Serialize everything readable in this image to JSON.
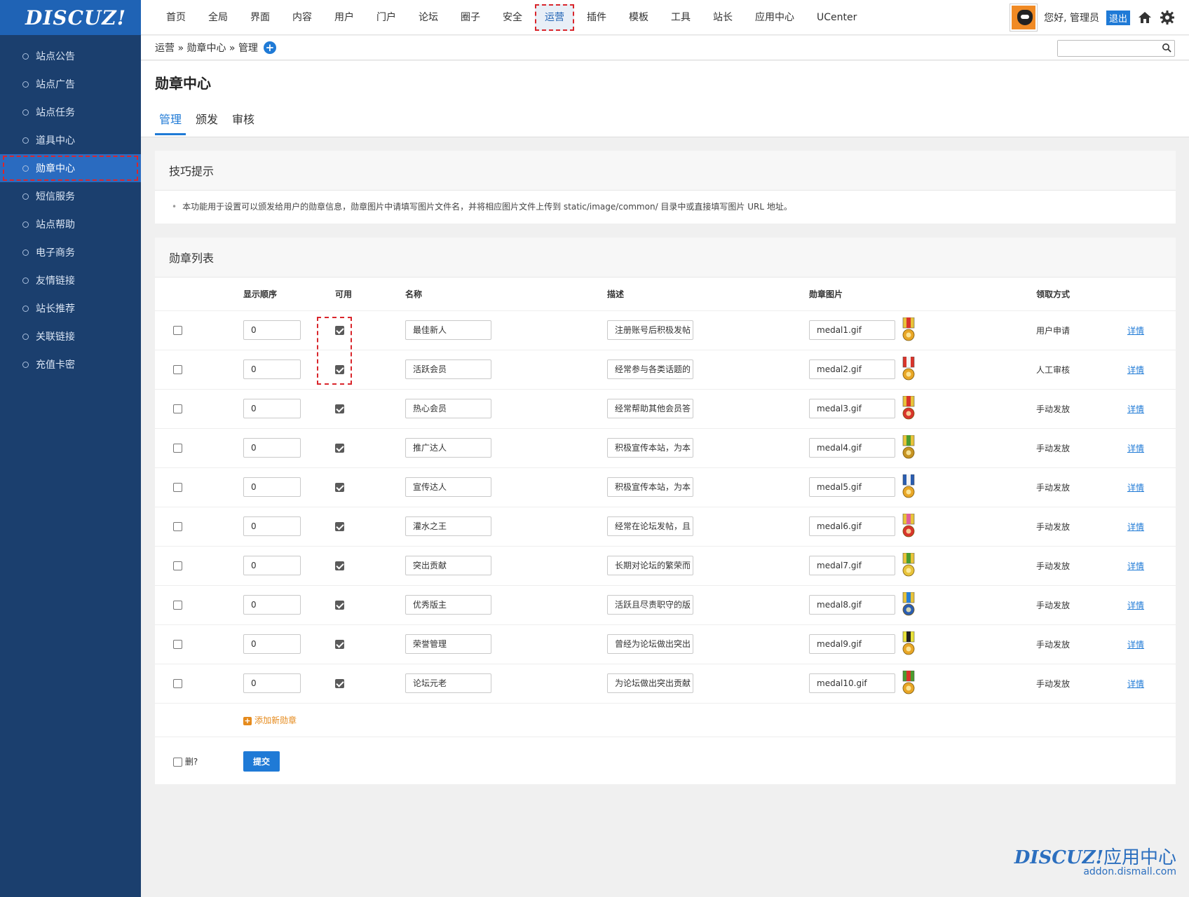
{
  "logo": "DISCUZ!",
  "sidebar": {
    "items": [
      {
        "label": "站点公告",
        "active": false
      },
      {
        "label": "站点广告",
        "active": false
      },
      {
        "label": "站点任务",
        "active": false
      },
      {
        "label": "道具中心",
        "active": false
      },
      {
        "label": "勋章中心",
        "active": true
      },
      {
        "label": "短信服务",
        "active": false
      },
      {
        "label": "站点帮助",
        "active": false
      },
      {
        "label": "电子商务",
        "active": false
      },
      {
        "label": "友情链接",
        "active": false
      },
      {
        "label": "站长推荐",
        "active": false
      },
      {
        "label": "关联链接",
        "active": false
      },
      {
        "label": "充值卡密",
        "active": false
      }
    ]
  },
  "topnav": {
    "items": [
      "首页",
      "全局",
      "界面",
      "内容",
      "用户",
      "门户",
      "论坛",
      "圈子",
      "安全",
      "运营",
      "插件",
      "模板",
      "工具",
      "站长",
      "应用中心",
      "UCenter"
    ],
    "active_index": 9,
    "greeting": "您好, 管理员",
    "logout": "退出"
  },
  "breadcrumb": {
    "path": [
      "运营",
      "勋章中心",
      "管理"
    ],
    "sep": " » "
  },
  "page": {
    "title": "勋章中心",
    "tabs": [
      "管理",
      "颁发",
      "审核"
    ],
    "active_tab": 0
  },
  "tips": {
    "title": "技巧提示",
    "text": "本功能用于设置可以颁发给用户的勋章信息，勋章图片中请填写图片文件名，并将相应图片文件上传到 static/image/common/ 目录中或直接填写图片 URL 地址。"
  },
  "medal_list": {
    "title": "勋章列表",
    "headers": {
      "order": "显示顺序",
      "available": "可用",
      "name": "名称",
      "desc": "描述",
      "image": "勋章图片",
      "method": "领取方式"
    },
    "rows": [
      {
        "order": "0",
        "available": true,
        "name": "最佳新人",
        "desc": "注册账号后积极发帖",
        "image": "medal1.gif",
        "method": "用户申请",
        "detail": "详情",
        "medal_colors": [
          "#e8c33a",
          "#d8342b",
          "#e8a626"
        ]
      },
      {
        "order": "0",
        "available": true,
        "name": "活跃会员",
        "desc": "经常参与各类话题的",
        "image": "medal2.gif",
        "method": "人工审核",
        "detail": "详情",
        "medal_colors": [
          "#d8342b",
          "#f4f4f4",
          "#e8a626"
        ]
      },
      {
        "order": "0",
        "available": true,
        "name": "热心会员",
        "desc": "经常帮助其他会员答",
        "image": "medal3.gif",
        "method": "手动发放",
        "detail": "详情",
        "medal_colors": [
          "#e8c33a",
          "#d8342b",
          "#d8342b"
        ]
      },
      {
        "order": "0",
        "available": true,
        "name": "推广达人",
        "desc": "积极宣传本站，为本",
        "image": "medal4.gif",
        "method": "手动发放",
        "detail": "详情",
        "medal_colors": [
          "#e8c33a",
          "#4a9c2f",
          "#c69321"
        ]
      },
      {
        "order": "0",
        "available": true,
        "name": "宣传达人",
        "desc": "积极宣传本站，为本",
        "image": "medal5.gif",
        "method": "手动发放",
        "detail": "详情",
        "medal_colors": [
          "#2a5db0",
          "#f4f4f4",
          "#e8a626"
        ]
      },
      {
        "order": "0",
        "available": true,
        "name": "灌水之王",
        "desc": "经常在论坛发帖，且",
        "image": "medal6.gif",
        "method": "手动发放",
        "detail": "详情",
        "medal_colors": [
          "#e8c33a",
          "#e0609a",
          "#d8342b"
        ]
      },
      {
        "order": "0",
        "available": true,
        "name": "突出贡献",
        "desc": "长期对论坛的繁荣而",
        "image": "medal7.gif",
        "method": "手动发放",
        "detail": "详情",
        "medal_colors": [
          "#e8c33a",
          "#4a9c2f",
          "#e8c33a"
        ]
      },
      {
        "order": "0",
        "available": true,
        "name": "优秀版主",
        "desc": "活跃且尽责职守的版",
        "image": "medal8.gif",
        "method": "手动发放",
        "detail": "详情",
        "medal_colors": [
          "#e8c33a",
          "#2a7fd4",
          "#2a5db0"
        ]
      },
      {
        "order": "0",
        "available": true,
        "name": "荣誉管理",
        "desc": "曾经为论坛做出突出",
        "image": "medal9.gif",
        "method": "手动发放",
        "detail": "详情",
        "medal_colors": [
          "#e8e23a",
          "#222222",
          "#e8a626"
        ]
      },
      {
        "order": "0",
        "available": true,
        "name": "论坛元老",
        "desc": "为论坛做出突出贡献",
        "image": "medal10.gif",
        "method": "手动发放",
        "detail": "详情",
        "medal_colors": [
          "#4a9c2f",
          "#d8342b",
          "#e8a626"
        ]
      }
    ],
    "add_label": "添加新勋章",
    "delete_label": "删?",
    "submit_label": "提交"
  },
  "watermark": {
    "brand": "DISCUZ!",
    "brand_cn": "应用中心",
    "url": "addon.dismall.com"
  }
}
